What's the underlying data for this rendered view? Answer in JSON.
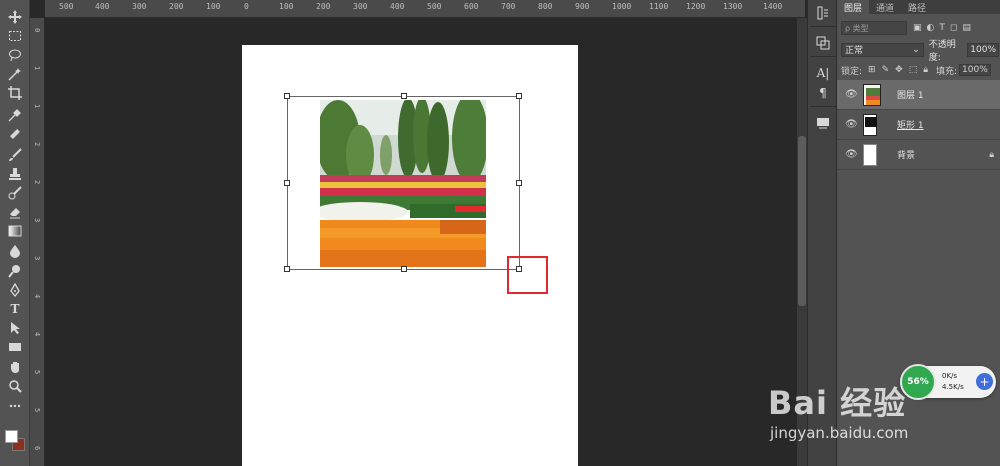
{
  "ruler": {
    "ticks": [
      "500",
      "450",
      "400",
      "350",
      "300",
      "250",
      "200",
      "150",
      "100",
      "50",
      "0",
      "50",
      "100",
      "150",
      "200",
      "250",
      "300",
      "350",
      "400",
      "450",
      "500",
      "550",
      "600",
      "650",
      "700",
      "750",
      "800",
      "850",
      "900",
      "950",
      "1000",
      "1050",
      "1100",
      "1150",
      "1200",
      "1250",
      "1300",
      "1350",
      "1400"
    ]
  },
  "ruler_visible": [
    "500",
    "400",
    "300",
    "200",
    "100",
    "0",
    "100",
    "200",
    "300",
    "400",
    "500",
    "600",
    "700",
    "800",
    "900",
    "1000",
    "1100",
    "1200",
    "1300",
    "1400"
  ],
  "ruler_left": [
    "0",
    "1",
    "1",
    "2",
    "2",
    "3",
    "3",
    "4",
    "4",
    "5",
    "5",
    "6"
  ],
  "layers_panel": {
    "tabs": [
      "图层",
      "通道",
      "路径"
    ],
    "filter_placeholder": "ρ 类型",
    "blend_mode": "正常",
    "opacity_label": "不透明度:",
    "opacity_value": "100%",
    "lock_label": "锁定:",
    "fill_label": "填充:",
    "fill_value": "100%",
    "layers": [
      {
        "name": "图层 1",
        "selected": true
      },
      {
        "name": "矩形 1",
        "selected": false
      },
      {
        "name": "背景",
        "selected": false,
        "locked": true
      }
    ]
  },
  "net_widget": {
    "percent": "56%",
    "up": "0K/s",
    "down": "4.5K/s"
  },
  "watermark": {
    "logo": "Bai 经验",
    "url": "jingyan.baidu.com"
  },
  "colors": {
    "foreground": "#ffffff",
    "background": "#8b2f20",
    "highlight": "#e0282e"
  },
  "icons": [
    "move-icon",
    "marquee-icon",
    "lasso-icon",
    "magic-wand-icon",
    "crop-icon",
    "eyedropper-icon",
    "healing-icon",
    "brush-icon",
    "stamp-icon",
    "history-brush-icon",
    "eraser-icon",
    "gradient-icon",
    "blur-icon",
    "dodge-icon",
    "pen-icon",
    "type-icon",
    "path-select-icon",
    "rectangle-icon",
    "hand-icon",
    "zoom-icon",
    "more-icon"
  ]
}
